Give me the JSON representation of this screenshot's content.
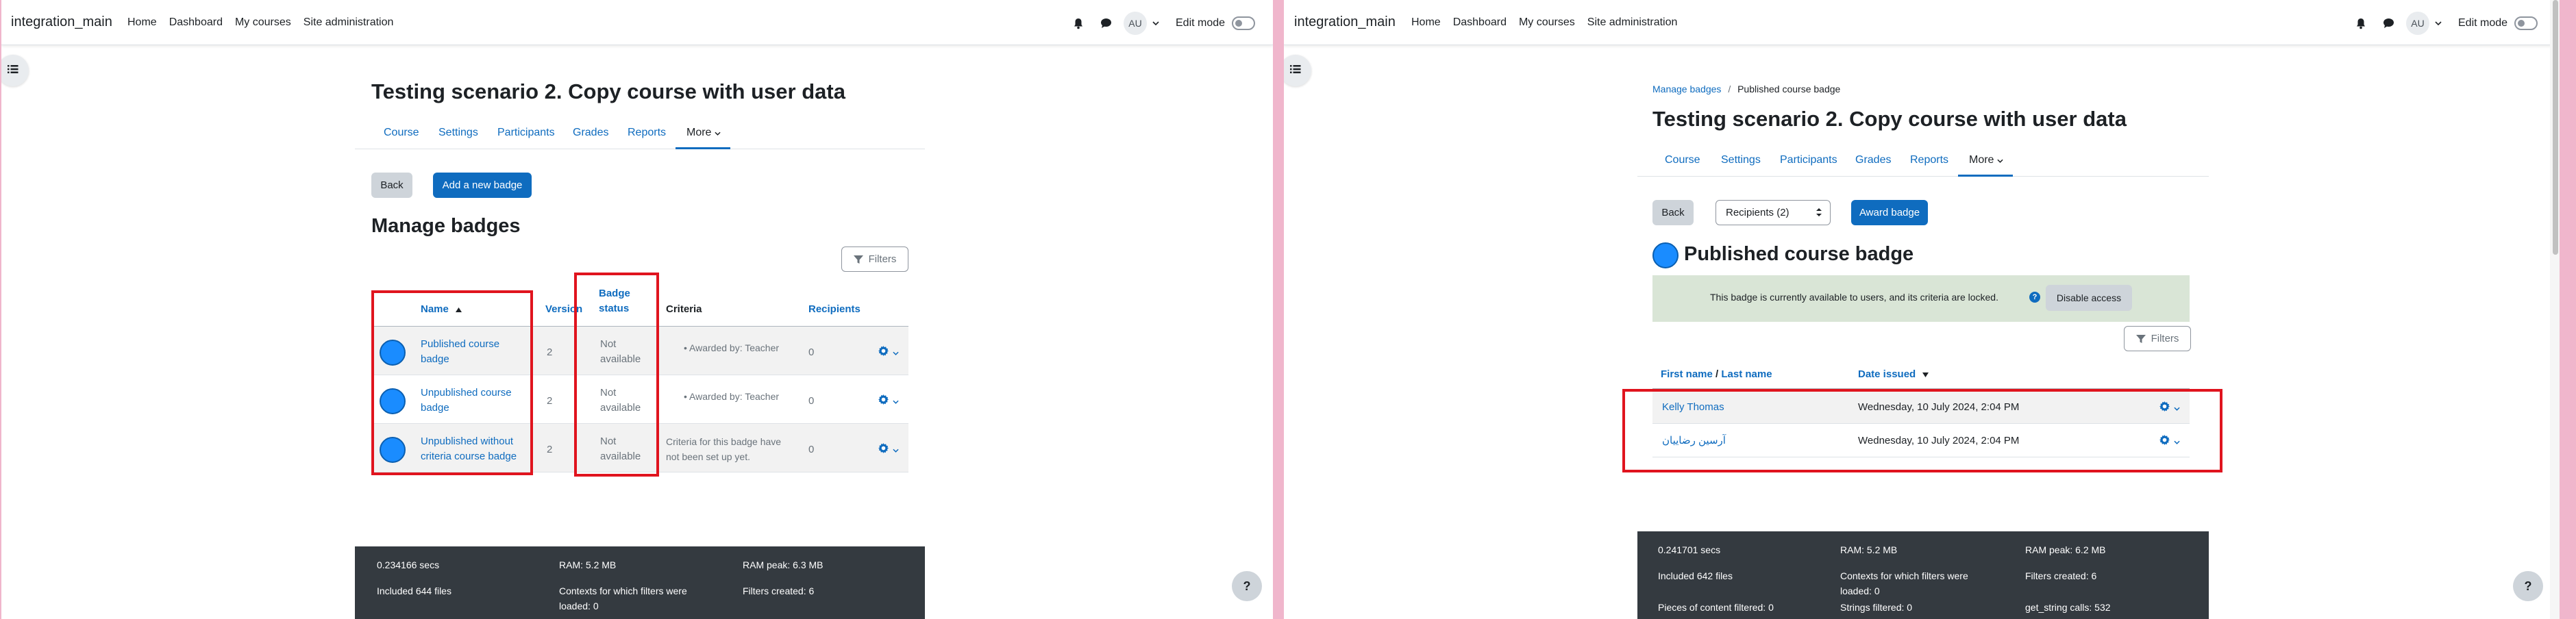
{
  "left": {
    "brand": "integration_main",
    "nav": [
      "Home",
      "Dashboard",
      "My courses",
      "Site administration"
    ],
    "avatar_initials": "AU",
    "edit_mode_label": "Edit mode",
    "course_title": "Testing scenario 2. Copy course with user data",
    "tabs": [
      "Course",
      "Settings",
      "Participants",
      "Grades",
      "Reports",
      "More"
    ],
    "back_label": "Back",
    "add_badge_label": "Add a new badge",
    "heading": "Manage badges",
    "filters_label": "Filters",
    "columns": {
      "name": "Name",
      "version": "Version",
      "badge_status_1": "Badge",
      "badge_status_2": "status",
      "criteria": "Criteria",
      "recipients": "Recipients"
    },
    "rows": [
      {
        "name_1": "Published course",
        "name_2": "badge",
        "version": "2",
        "status_1": "Not",
        "status_2": "available",
        "criteria": "Awarded by: Teacher",
        "recipients": "0"
      },
      {
        "name_1": "Unpublished course",
        "name_2": "badge",
        "version": "2",
        "status_1": "Not",
        "status_2": "available",
        "criteria": "Awarded by: Teacher",
        "recipients": "0"
      },
      {
        "name_1": "Unpublished without",
        "name_2": "criteria course badge",
        "version": "2",
        "status_1": "Not",
        "status_2": "available",
        "criteria_1": "Criteria for this badge have",
        "criteria_2": "not been set up yet.",
        "recipients": "0"
      }
    ],
    "footer": {
      "secs": "0.234166 secs",
      "ram": "RAM: 5.2 MB",
      "ram_peak": "RAM peak: 6.3 MB",
      "files": "Included 644 files",
      "contexts_1": "Contexts for which filters were",
      "contexts_2": "loaded: 0",
      "filters_created": "Filters created: 6"
    },
    "help": "?"
  },
  "right": {
    "brand": "integration_main",
    "nav": [
      "Home",
      "Dashboard",
      "My courses",
      "Site administration"
    ],
    "avatar_initials": "AU",
    "edit_mode_label": "Edit mode",
    "breadcrumb": [
      "Manage badges",
      "Published course badge"
    ],
    "course_title": "Testing scenario 2. Copy course with user data",
    "tabs": [
      "Course",
      "Settings",
      "Participants",
      "Grades",
      "Reports",
      "More"
    ],
    "back_label": "Back",
    "recipients_select": "Recipients (2)",
    "award_label": "Award badge",
    "heading": "Published course badge",
    "alert_text": "This badge is currently available to users, and its criteria are locked.",
    "disable_access": "Disable access",
    "filters_label": "Filters",
    "columns": {
      "first_name": "First name",
      "slash": " / ",
      "last_name": "Last name",
      "date_issued": "Date issued"
    },
    "rows": [
      {
        "name": "Kelly Thomas",
        "date": "Wednesday, 10 July 2024, 2:04 PM"
      },
      {
        "name": "آرسین رضاییان",
        "date": "Wednesday, 10 July 2024, 2:04 PM"
      }
    ],
    "footer": {
      "secs": "0.241701 secs",
      "ram": "RAM: 5.2 MB",
      "ram_peak": "RAM peak: 6.2 MB",
      "files": "Included 642 files",
      "contexts_1": "Contexts for which filters were",
      "contexts_2": "loaded: 0",
      "filters_created": "Filters created: 6",
      "pieces": "Pieces of content filtered: 0",
      "strings": "Strings filtered: 0",
      "get_string": "get_string calls: 532"
    },
    "help": "?"
  },
  "colors": {
    "primary": "#0f6cbf",
    "red_highlight": "#e0141e",
    "footer_bg": "#343a40",
    "divider": "#f0b6cc"
  }
}
